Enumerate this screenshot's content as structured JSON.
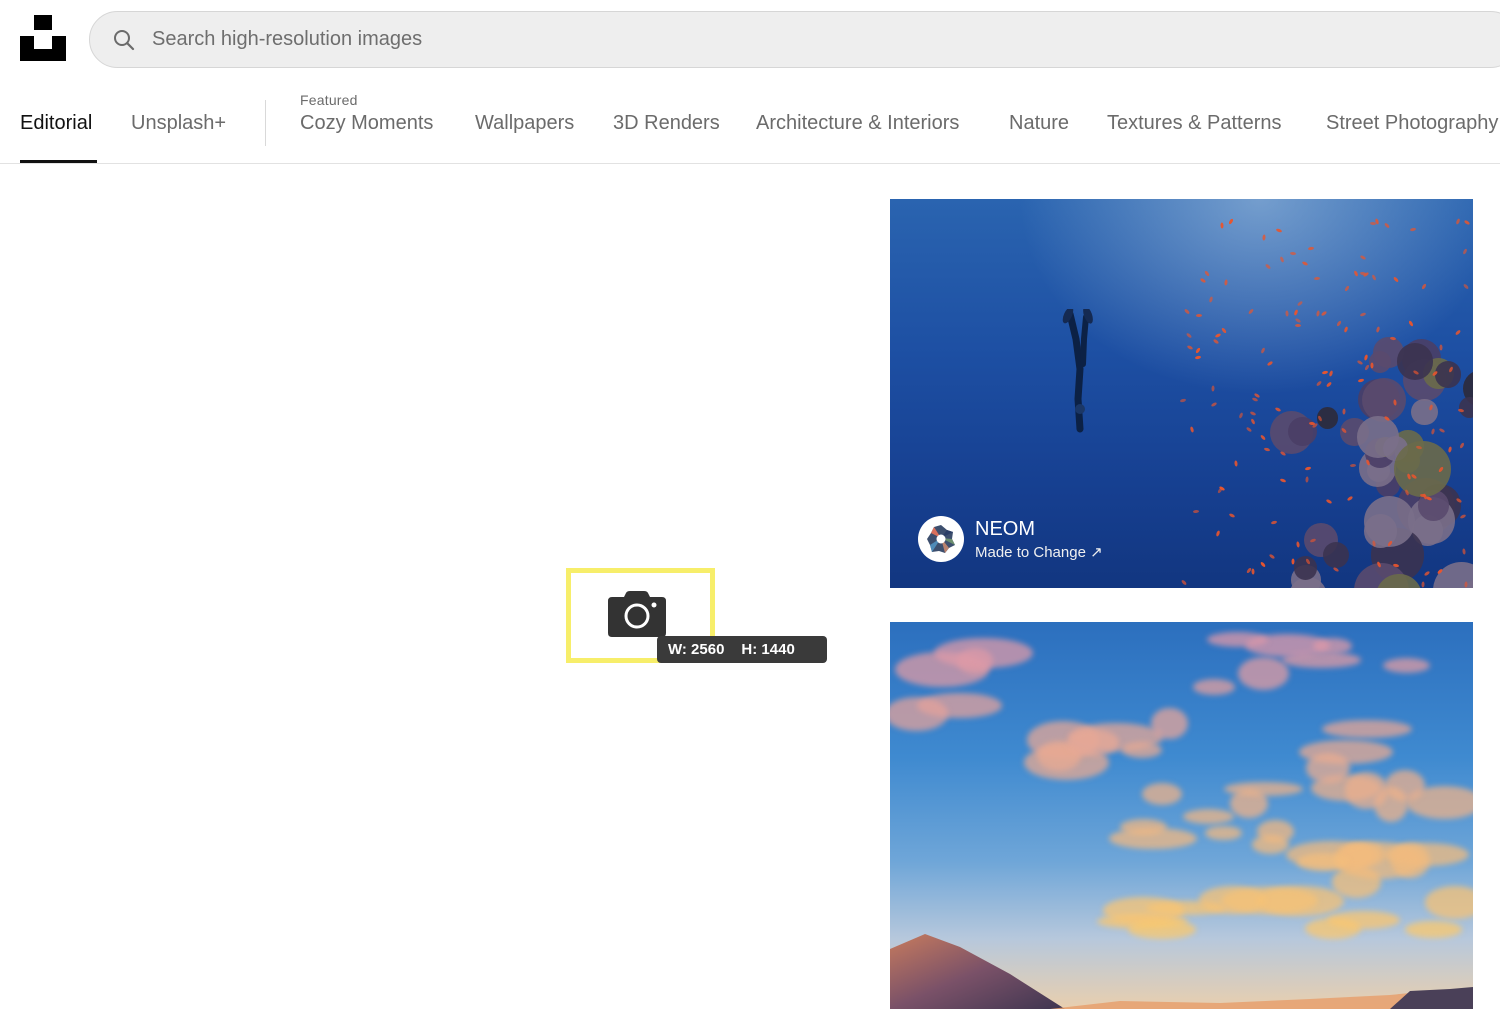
{
  "header": {
    "logo": "unsplash-logo",
    "search": {
      "placeholder": "Search high-resolution images",
      "value": "",
      "icon": "search-icon"
    }
  },
  "nav": {
    "featured_label": "Featured",
    "items": [
      {
        "label": "Editorial",
        "active": true
      },
      {
        "label": "Unsplash+",
        "active": false
      },
      {
        "label": "Cozy Moments",
        "active": false
      },
      {
        "label": "Wallpapers",
        "active": false
      },
      {
        "label": "3D Renders",
        "active": false
      },
      {
        "label": "Architecture & Interiors",
        "active": false
      },
      {
        "label": "Nature",
        "active": false
      },
      {
        "label": "Textures & Patterns",
        "active": false
      },
      {
        "label": "Street Photography",
        "active": false
      }
    ]
  },
  "feed": {
    "photos": [
      {
        "subject": "underwater freediver over coral reef",
        "sponsor": {
          "name": "NEOM",
          "tagline": "Made to Change ↗"
        }
      },
      {
        "subject": "pink clouds in blue sunset sky over mountains"
      }
    ]
  },
  "overlay": {
    "icon": "camera-icon",
    "width_label": "W: 2560",
    "height_label": "H: 1440",
    "highlight_color": "#f7ee6a"
  }
}
